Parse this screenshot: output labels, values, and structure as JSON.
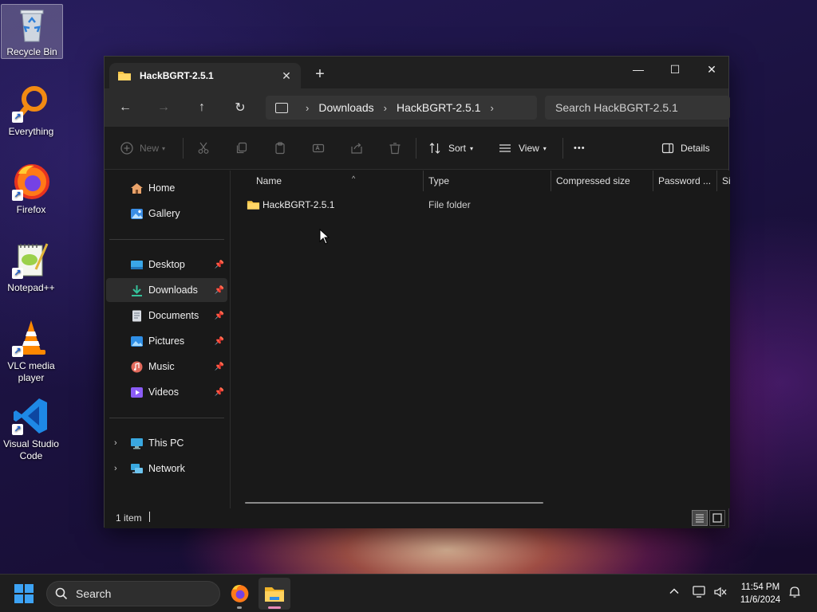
{
  "desktop": {
    "icons": [
      {
        "label": "Recycle Bin"
      },
      {
        "label": "Everything"
      },
      {
        "label": "Firefox"
      },
      {
        "label": "Notepad++"
      },
      {
        "label": "VLC media player"
      },
      {
        "label": "Visual Studio Code"
      }
    ]
  },
  "window": {
    "tab_title": "HackBGRT-2.5.1",
    "tab_close": "✕",
    "new_tab": "+",
    "controls": {
      "minimize": "—",
      "maximize": "☐",
      "close": "✕"
    },
    "nav": {
      "back": "←",
      "forward": "→",
      "up": "↑",
      "refresh": "↻"
    },
    "breadcrumb": [
      "Downloads",
      "HackBGRT-2.5.1"
    ],
    "search_placeholder": "Search HackBGRT-2.5.1",
    "commands": {
      "new": "New",
      "sort": "Sort",
      "view": "View",
      "more": "•••",
      "details": "Details"
    },
    "sidebar": {
      "top": [
        {
          "label": "Home"
        },
        {
          "label": "Gallery"
        }
      ],
      "quick_access": [
        {
          "label": "Desktop",
          "pinned": true
        },
        {
          "label": "Downloads",
          "pinned": true,
          "selected": true
        },
        {
          "label": "Documents",
          "pinned": true
        },
        {
          "label": "Pictures",
          "pinned": true
        },
        {
          "label": "Music",
          "pinned": true
        },
        {
          "label": "Videos",
          "pinned": true
        }
      ],
      "tree": [
        {
          "label": "This PC"
        },
        {
          "label": "Network"
        }
      ]
    },
    "columns": [
      "Name",
      "Type",
      "Compressed size",
      "Password ...",
      "Si"
    ],
    "files": [
      {
        "name": "HackBGRT-2.5.1",
        "type": "File folder",
        "compressed_size": "",
        "password": ""
      }
    ],
    "status": {
      "item_count": "1 item"
    }
  },
  "taskbar": {
    "search_label": "Search",
    "clock": {
      "time": "11:54 PM",
      "date": "11/6/2024"
    },
    "accent": "#3da3f5"
  }
}
